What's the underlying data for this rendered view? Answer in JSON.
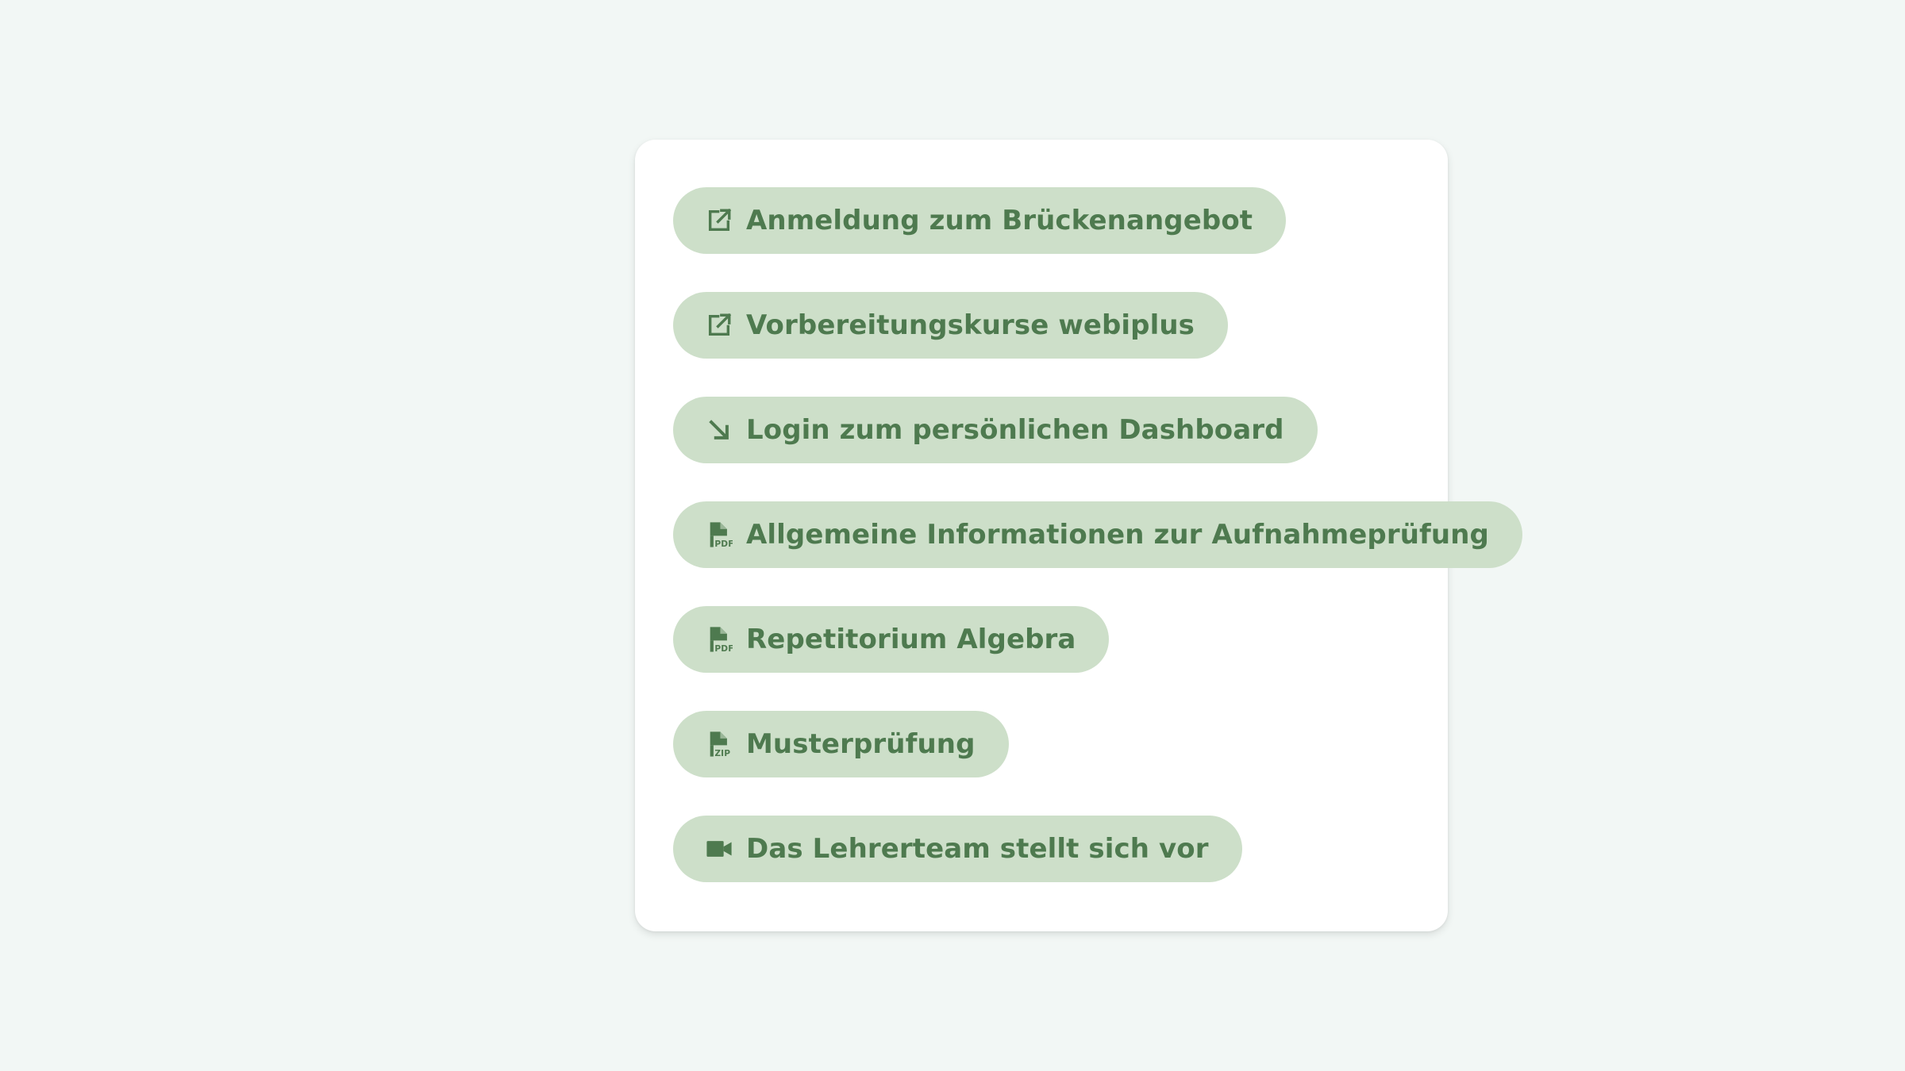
{
  "theme": {
    "page_background": "#f2f7f5",
    "card_background": "#ffffff",
    "chip_background": "#cddfc9",
    "chip_text": "#4e7a4f"
  },
  "links": [
    {
      "label": "Anmeldung zum Brückenangebot",
      "icon": "external-link-icon"
    },
    {
      "label": "Vorbereitungskurse webiplus",
      "icon": "external-link-icon"
    },
    {
      "label": "Login zum persönlichen Dashboard",
      "icon": "arrow-down-right-icon"
    },
    {
      "label": "Allgemeine Informationen zur Aufnahmeprüfung",
      "icon": "pdf-file-icon",
      "icon_text": "PDF"
    },
    {
      "label": "Repetitorium Algebra",
      "icon": "pdf-file-icon",
      "icon_text": "PDF"
    },
    {
      "label": "Musterprüfung",
      "icon": "zip-file-icon",
      "icon_text": "ZIP"
    },
    {
      "label": "Das Lehrerteam stellt sich vor",
      "icon": "video-camera-icon"
    }
  ]
}
